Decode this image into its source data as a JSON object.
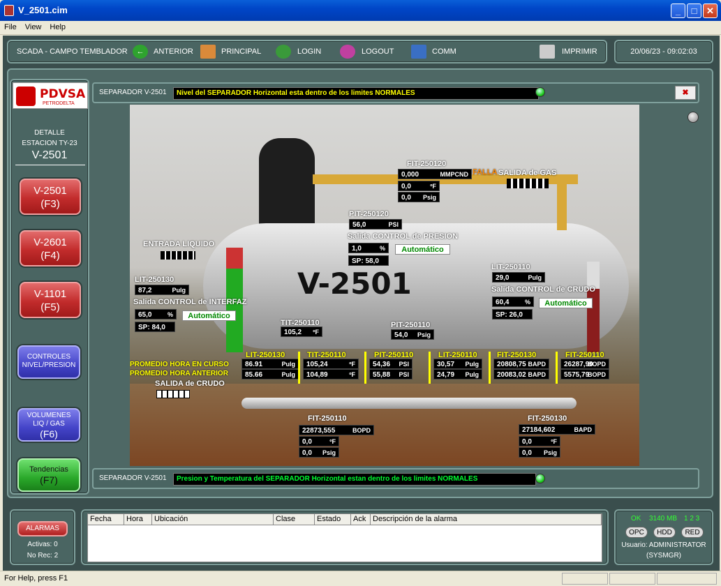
{
  "window": {
    "title": "V_2501.cim"
  },
  "menu": [
    "File",
    "View",
    "Help"
  ],
  "toolbar": {
    "system": "SCADA - CAMPO TEMBLADOR",
    "anterior": "ANTERIOR",
    "principal": "PRINCIPAL",
    "login": "LOGIN",
    "logout": "LOGOUT",
    "comm": "COMM",
    "imprimir": "IMPRIMIR",
    "datetime": "20/06/23 - 09:02:03"
  },
  "logo": {
    "text": "PDVSA",
    "sub": "PETRODELTA"
  },
  "nav": {
    "detalle": "DETALLE",
    "estacion": "ESTACION TY-23",
    "equipo": "V-2501",
    "b1": "V-2501",
    "b1k": "(F3)",
    "b2": "V-2601",
    "b2k": "(F4)",
    "b3": "V-1101",
    "b3k": "(F5)",
    "controles1": "CONTROLES",
    "controles2": "NIVEL/PRESION",
    "vol1": "VOLUMENES",
    "vol2": "LIQ / GAS",
    "vol3": "(F6)",
    "tend1": "Tendencias",
    "tend2": "(F7)"
  },
  "msg_top": {
    "tag": "SEPARADOR V-2501",
    "text": "Nivel del SEPARADOR Horizontal esta dentro de los limites NORMALES"
  },
  "msg_bottom": {
    "tag": "SEPARADOR V-2501",
    "text": "Presion y Temperatura del SEPARADOR Horizontal estan dentro de los limites NORMALES"
  },
  "scene": {
    "vessel": "V-2501",
    "fit250120": {
      "tag": "FIT-250120",
      "v1": "0,000",
      "u1": "MMPCND",
      "v2": "0,0",
      "u2": "ºF",
      "v3": "0,0",
      "u3": "Psig",
      "falla": "FALLA",
      "salida": "SALIDA de GAS"
    },
    "pit250120": {
      "tag": "PIT-250120",
      "v": "56,0",
      "u": "PSI",
      "ctrl": "Salida CONTROL de PRESION",
      "out": "1,0",
      "outu": "%",
      "mode": "Automático",
      "sp": "SP: 58,0"
    },
    "entrada": "ENTRADA LIQUIDO",
    "lit250130": {
      "tag": "LIT-250130",
      "v": "87,2",
      "u": "Pulg",
      "ctrl": "Salida CONTROL de INTERFAZ",
      "out": "65,0",
      "outu": "%",
      "mode": "Automático",
      "sp": "SP: 84,0"
    },
    "lit250110": {
      "tag": "LIT-250110",
      "v": "29,0",
      "u": "Pulg",
      "ctrl": "Salida CONTROL de CRUDO",
      "out": "60,4",
      "outu": "%",
      "mode": "Automático",
      "sp": "SP: 26,0"
    },
    "tit250110": {
      "tag": "TIT-250110",
      "v": "105,2",
      "u": "ºF"
    },
    "pit250110": {
      "tag": "PIT-250110",
      "v": "54,0",
      "u": "Psig"
    },
    "prom_curso": "PROMEDIO HORA EN CURSO",
    "prom_anterior": "PROMEDIO HORA ANTERIOR",
    "avg": [
      {
        "tag": "LIT-250130",
        "a": "86.91",
        "b": "85.66",
        "u": "Pulg"
      },
      {
        "tag": "TIT-250110",
        "a": "105,24",
        "b": "104,89",
        "u": "ºF"
      },
      {
        "tag": "PIT-250110",
        "a": "54,36",
        "b": "55,88",
        "u": "PSI"
      },
      {
        "tag": "LIT-250110",
        "a": "30,57",
        "b": "24,79",
        "u": "Pulg"
      },
      {
        "tag": "FIT-250130",
        "a": "20808,75",
        "b": "20083,02",
        "u": "BAPD"
      },
      {
        "tag": "FIT-250110",
        "a": "26287,90",
        "b": "5575,79",
        "u": "BOPD"
      }
    ],
    "salida_crudo": "SALIDA de CRUDO",
    "fit250110": {
      "tag": "FIT-250110",
      "v1": "22873,555",
      "u1": "BOPD",
      "v2": "0,0",
      "u2": "ºF",
      "v3": "0,0",
      "u3": "Psig"
    },
    "fit250130": {
      "tag": "FIT-250130",
      "v1": "27184,602",
      "u1": "BAPD",
      "v2": "0,0",
      "u2": "ºF",
      "v3": "0,0",
      "u3": "Psig"
    }
  },
  "alarms": {
    "button": "ALARMAS",
    "activas": "Activas: 0",
    "norec": "No Rec: 2",
    "columns": [
      "Fecha",
      "Hora",
      "Ubicación",
      "Clase",
      "Estado",
      "Ack",
      "Descripción de la alarma"
    ]
  },
  "status": {
    "ok": "OK",
    "mem": "3140 MB",
    "nums": "1 2 3",
    "opc": "OPC",
    "hdd": "HDD",
    "red": "RED",
    "user": "Usuario: ADMINISTRATOR",
    "role": "(SYSMGR)"
  },
  "statusbar": "For Help, press F1"
}
